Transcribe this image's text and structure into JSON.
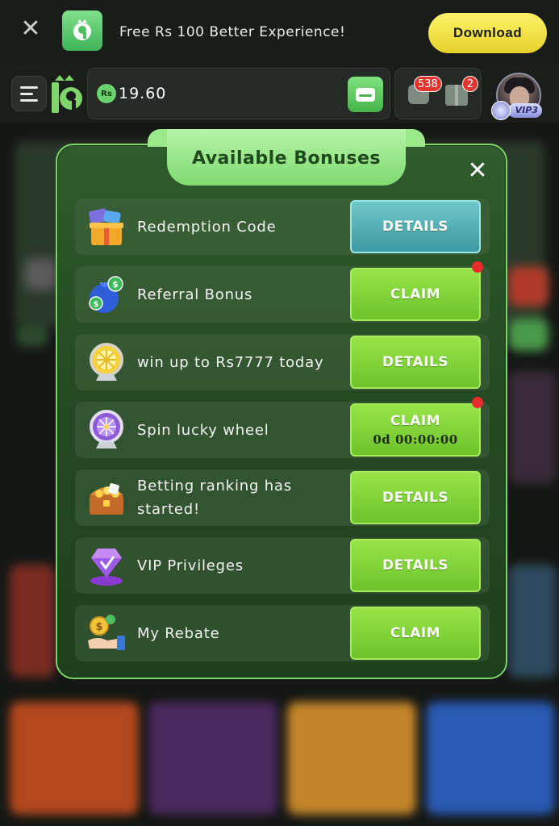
{
  "banner": {
    "close_glyph": "✕",
    "app_icon": "b9-logo-icon",
    "text": "Free Rs 100 Better Experience!",
    "download_label": "Download",
    "accent": "#f0de3a"
  },
  "topbar": {
    "currency_symbol": "Rs",
    "balance": "19.60",
    "chat_count": "538",
    "gift_count": "2",
    "vip_level": "VIP3"
  },
  "modal": {
    "title": "Available Bonuses",
    "close_glyph": "✕",
    "rows": [
      {
        "icon": "gift-box-icon",
        "label": "Redemption Code",
        "button": "DETAILS",
        "button_style": "teal",
        "has_dot": false
      },
      {
        "icon": "money-bag-icon",
        "label": "Referral Bonus",
        "button": "CLAIM",
        "button_style": "green",
        "has_dot": true
      },
      {
        "icon": "trophy-wheel-icon",
        "label": "win up to Rs7777 today",
        "button": "DETAILS",
        "button_style": "green",
        "has_dot": false
      },
      {
        "icon": "lucky-wheel-icon",
        "label": "Spin lucky wheel",
        "button": "CLAIM",
        "timer": "0d 00:00:00",
        "button_style": "green",
        "has_dot": true
      },
      {
        "icon": "treasure-chest-icon",
        "label": "Betting ranking has started!",
        "button": "DETAILS",
        "button_style": "green",
        "has_dot": false
      },
      {
        "icon": "vip-gem-icon",
        "label": "VIP Privileges",
        "button": "DETAILS",
        "button_style": "green",
        "has_dot": false
      },
      {
        "icon": "coin-hand-icon",
        "label": "My Rebate",
        "button": "CLAIM",
        "button_style": "green",
        "has_dot": false
      }
    ]
  },
  "colors": {
    "button_green": "#7fd23a",
    "button_teal": "#4aa7ad",
    "notification_red": "#e92b2b",
    "modal_border": "#7ed46a"
  }
}
